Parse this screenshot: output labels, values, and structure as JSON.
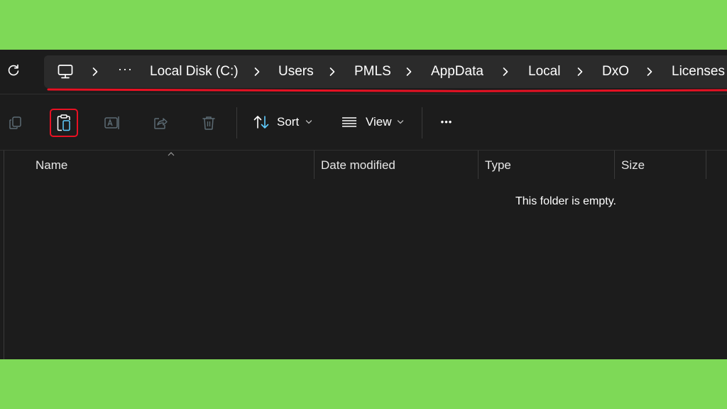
{
  "breadcrumb": {
    "overflow": "···",
    "items": [
      "Local Disk (C:)",
      "Users",
      "PMLS",
      "AppData",
      "Local",
      "DxO",
      "Licenses"
    ]
  },
  "toolbar": {
    "sort_label": "Sort",
    "view_label": "View",
    "more_label": "•••"
  },
  "columns": {
    "name": "Name",
    "date_modified": "Date modified",
    "type": "Type",
    "size": "Size"
  },
  "empty_message": "This folder is empty.",
  "colors": {
    "background": "#7ed957",
    "window": "#1c1c1c",
    "addressbar": "#2b2b2b",
    "highlight": "#e81123",
    "sort_accent": "#60cdff"
  }
}
